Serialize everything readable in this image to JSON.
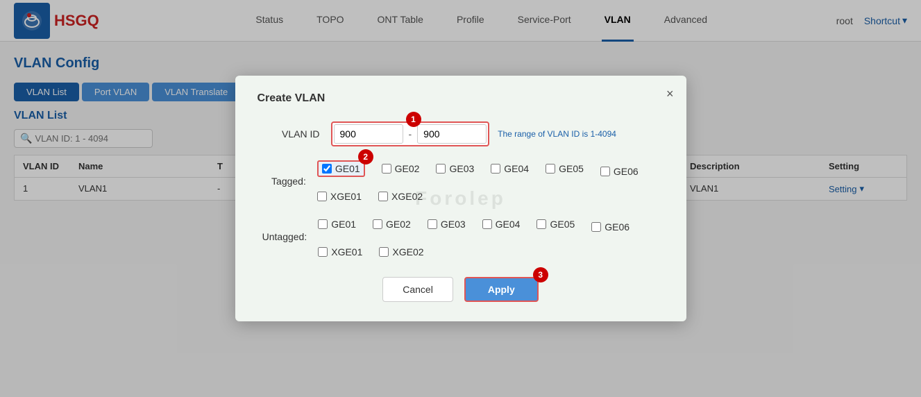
{
  "header": {
    "logo_text": "HSGQ",
    "nav": [
      {
        "label": "Status",
        "active": false
      },
      {
        "label": "TOPO",
        "active": false
      },
      {
        "label": "ONT Table",
        "active": false
      },
      {
        "label": "Profile",
        "active": false
      },
      {
        "label": "Service-Port",
        "active": false
      },
      {
        "label": "VLAN",
        "active": true
      },
      {
        "label": "Advanced",
        "active": false
      }
    ],
    "root_label": "root",
    "shortcut_label": "Shortcut",
    "chevron": "▾"
  },
  "page": {
    "title": "VLAN Config",
    "tabs": [
      {
        "label": "VLAN List",
        "active": true
      },
      {
        "label": "Port VLAN",
        "active": false
      },
      {
        "label": "VLAN Translate",
        "active": false
      }
    ],
    "section_title": "VLAN List",
    "search_placeholder": "VLAN ID: 1 - 4094",
    "table": {
      "headers": [
        "VLAN ID",
        "Name",
        "T",
        "",
        "Description",
        "Setting"
      ],
      "rows": [
        {
          "vlan_id": "1",
          "name": "VLAN1",
          "t": "-",
          "col3": "",
          "description": "VLAN1",
          "setting": "Setting"
        }
      ]
    }
  },
  "modal": {
    "title": "Create VLAN",
    "close_label": "×",
    "vlan_id_label": "VLAN ID",
    "vlan_id_from": "900",
    "vlan_id_to": "900",
    "vlan_range_hint": "The range of VLAN ID is 1-4094",
    "dash": "-",
    "tagged_label": "Tagged:",
    "untagged_label": "Untagged:",
    "tagged_ports": [
      {
        "id": "tagged_ge01",
        "label": "GE01",
        "checked": true,
        "highlighted": true
      },
      {
        "id": "tagged_ge02",
        "label": "GE02",
        "checked": false,
        "highlighted": false
      },
      {
        "id": "tagged_ge03",
        "label": "GE03",
        "checked": false,
        "highlighted": false
      },
      {
        "id": "tagged_ge04",
        "label": "GE04",
        "checked": false,
        "highlighted": false
      },
      {
        "id": "tagged_ge05",
        "label": "GE05",
        "checked": false,
        "highlighted": false
      },
      {
        "id": "tagged_ge06",
        "label": "GE06",
        "checked": false,
        "highlighted": false
      },
      {
        "id": "tagged_xge01",
        "label": "XGE01",
        "checked": false,
        "highlighted": false
      },
      {
        "id": "tagged_xge02",
        "label": "XGE02",
        "checked": false,
        "highlighted": false
      }
    ],
    "untagged_ports": [
      {
        "id": "untagged_ge01",
        "label": "GE01",
        "checked": false
      },
      {
        "id": "untagged_ge02",
        "label": "GE02",
        "checked": false
      },
      {
        "id": "untagged_ge03",
        "label": "GE03",
        "checked": false
      },
      {
        "id": "untagged_ge04",
        "label": "GE04",
        "checked": false
      },
      {
        "id": "untagged_ge05",
        "label": "GE05",
        "checked": false
      },
      {
        "id": "untagged_ge06",
        "label": "GE06",
        "checked": false
      },
      {
        "id": "untagged_xge01",
        "label": "XGE01",
        "checked": false
      },
      {
        "id": "untagged_xge02",
        "label": "XGE02",
        "checked": false
      }
    ],
    "cancel_label": "Cancel",
    "apply_label": "Apply",
    "annotations": [
      {
        "number": "1",
        "hint": "VLAN ID range input"
      },
      {
        "number": "2",
        "hint": "Tagged GE01 checkbox"
      },
      {
        "number": "3",
        "hint": "Apply button"
      }
    ],
    "watermark": "Forolep"
  }
}
